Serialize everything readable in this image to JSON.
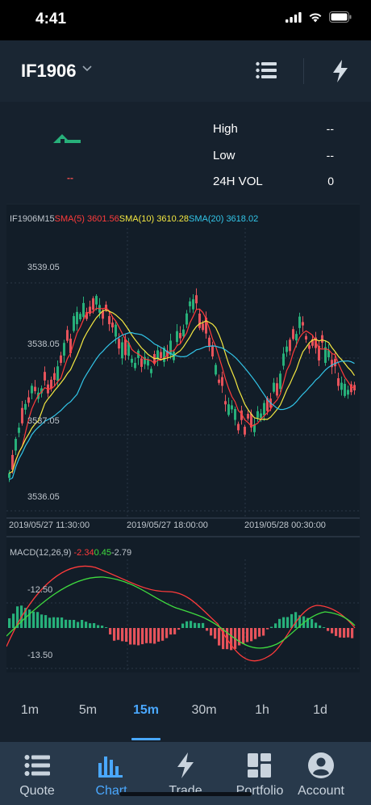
{
  "status": {
    "time": "4:41"
  },
  "header": {
    "symbol": "IF1906"
  },
  "stats": {
    "price_dash": "--",
    "rows": [
      {
        "label": "High",
        "value": "--"
      },
      {
        "label": "Low",
        "value": "--"
      },
      {
        "label": "24H VOL",
        "value": "0"
      }
    ]
  },
  "chart": {
    "symbol_label": "IF1906M15",
    "sma5": "SMA(5) 3601.56",
    "sma10": "SMA(10) 3610.28",
    "sma20": "SMA(20) 3618.02",
    "y_labels": [
      "3539.05",
      "3538.05",
      "3537.05",
      "3536.05"
    ],
    "x_labels": [
      "2019/05/27 11:30:00",
      "2019/05/27 18:00:00",
      "2019/05/28 00:30:00"
    ],
    "macd_label": "MACD(12,26,9)",
    "macd_dif": "-2.34",
    "macd_dea": "0.45",
    "macd_hist": "-2.79",
    "macd_y_labels": [
      "-12.50",
      "-13.50"
    ],
    "colors": {
      "up": "#27b07a",
      "down": "#e5535b",
      "sma5": "#ff3b3b",
      "sma10": "#f4e842",
      "sma20": "#32c5e8"
    }
  },
  "timeframes": {
    "active": "15m",
    "items": [
      "1m",
      "5m",
      "15m",
      "30m",
      "1h",
      "1d"
    ]
  },
  "tabs": {
    "active": "Chart",
    "items": [
      "Quote",
      "Chart",
      "Trade",
      "Portfolio",
      "Account"
    ]
  }
}
